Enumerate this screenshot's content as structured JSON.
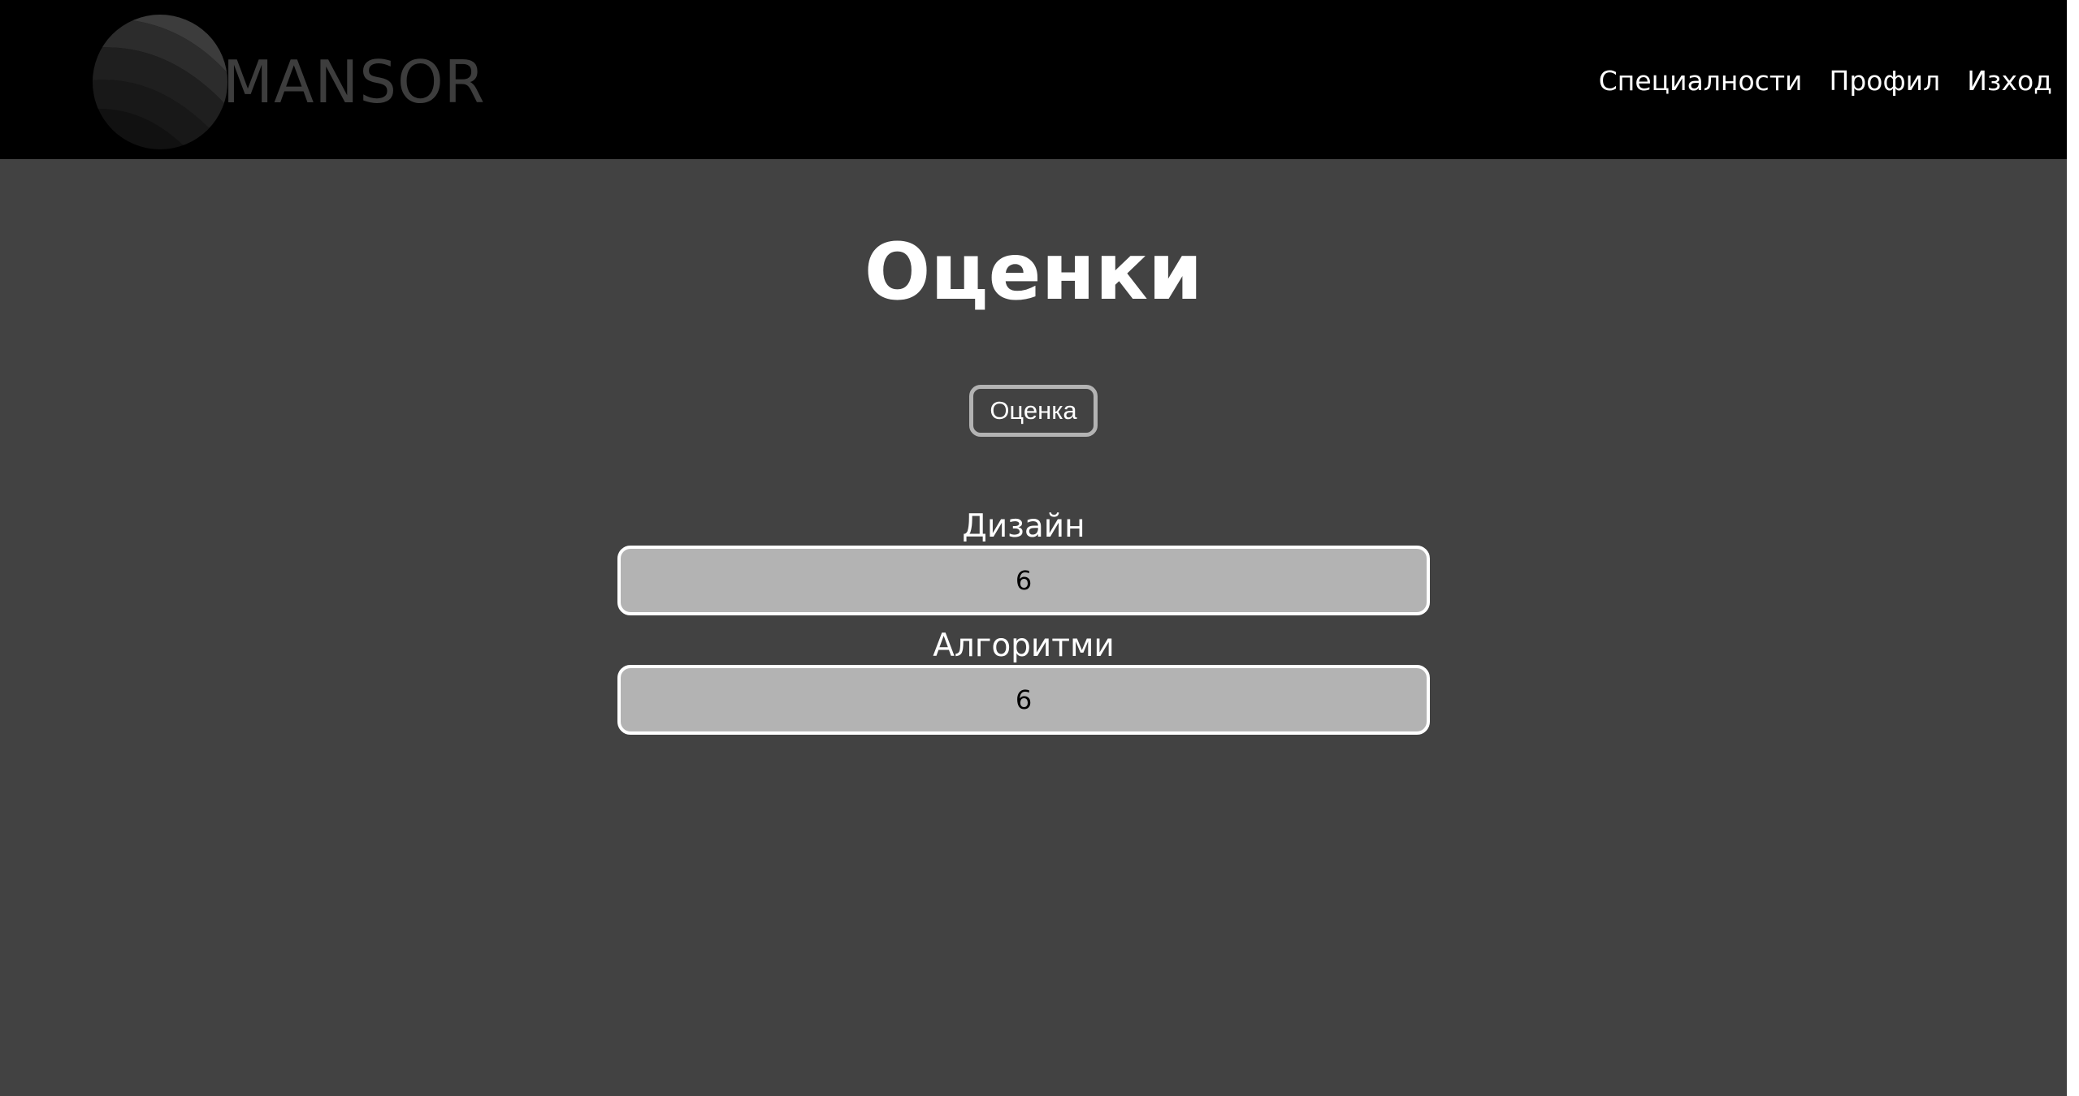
{
  "header": {
    "logo_text": "MANSOR",
    "nav": [
      {
        "label": "Специалности"
      },
      {
        "label": "Профил"
      },
      {
        "label": "Изход"
      }
    ]
  },
  "main": {
    "title": "Оценки",
    "grade_button_label": "Оценка",
    "subjects": [
      {
        "label": "Дизайн",
        "grade": "6"
      },
      {
        "label": "Алгоритми",
        "grade": "6"
      }
    ]
  },
  "colors": {
    "header_bg": "#000000",
    "page_bg": "#424242",
    "field_bg": "#b3b3b3",
    "text": "#ffffff"
  }
}
